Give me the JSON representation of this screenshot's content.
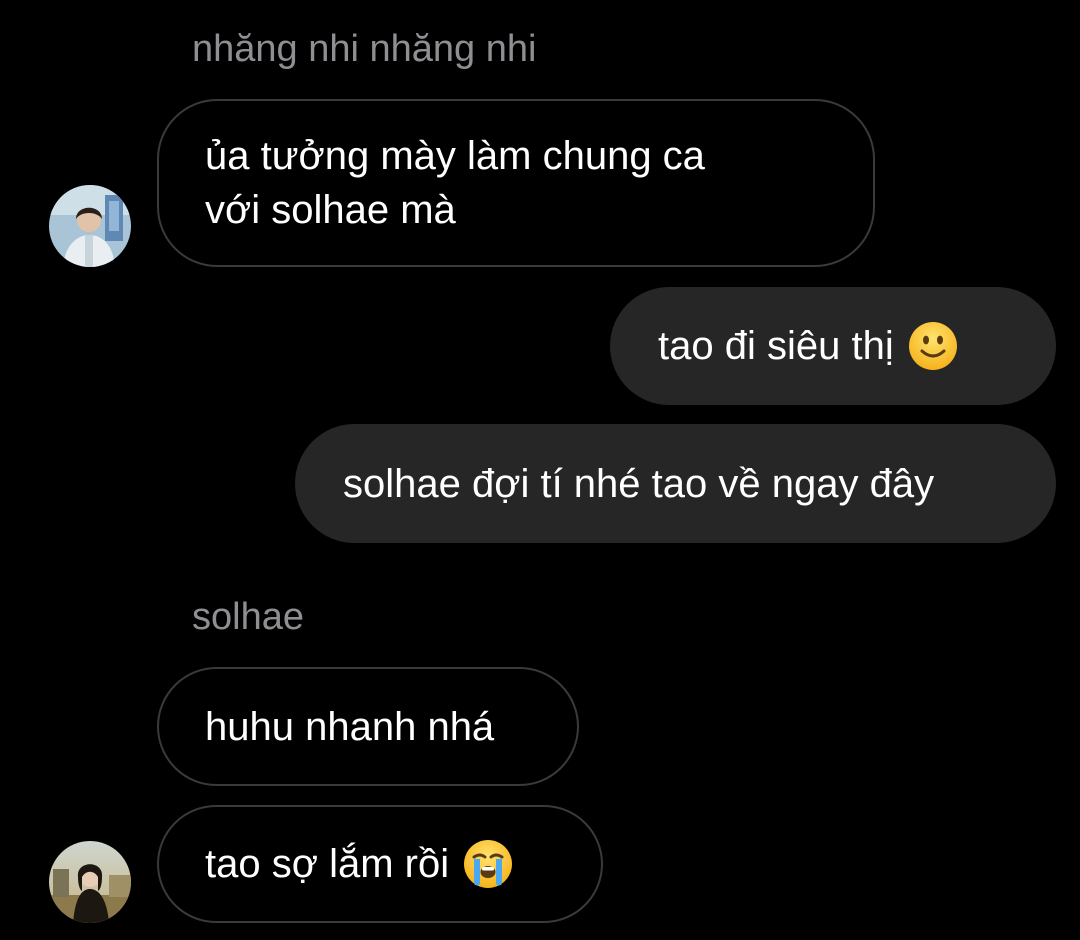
{
  "thread": {
    "groups": [
      {
        "sender": "nhăng nhi nhăng nhi",
        "messages": [
          {
            "text": "ủa tưởng mày làm chung ca\nvới solhae mà"
          }
        ]
      },
      {
        "sender": "",
        "outgoing": true,
        "messages": [
          {
            "text": "tao đi siêu thị",
            "emoji": "slightly-smiling-face-emoji"
          },
          {
            "text": "solhae đợi tí nhé tao về ngay đây"
          }
        ]
      },
      {
        "sender": "solhae",
        "messages": [
          {
            "text": "huhu nhanh nhá"
          },
          {
            "text": "tao sợ lắm rồi",
            "emoji": "loudly-crying-face-emoji"
          }
        ]
      }
    ]
  },
  "colors": {
    "background": "#000000",
    "sender_name": "#8e8e93",
    "incoming_border": "#3a3a3c",
    "outgoing_bubble": "#262626",
    "text": "#ffffff"
  }
}
